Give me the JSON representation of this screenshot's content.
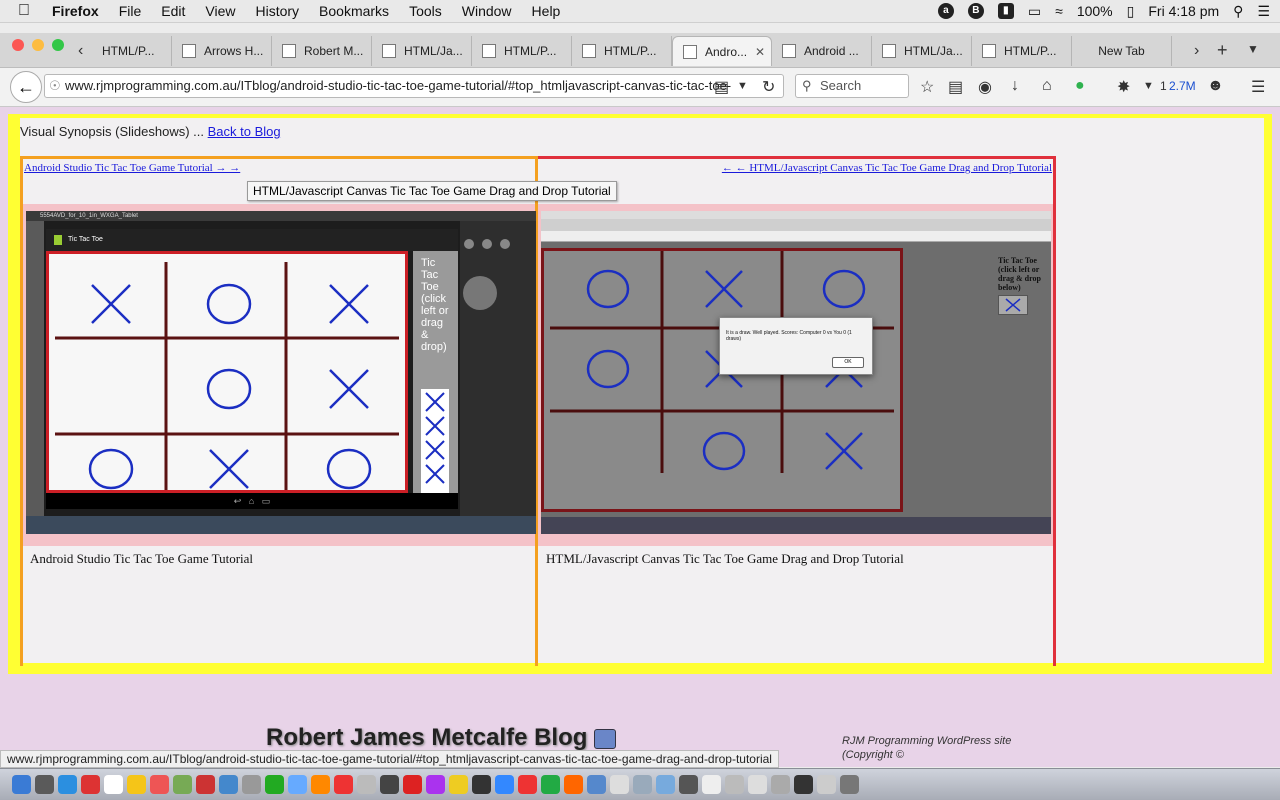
{
  "menubar": {
    "app": "Firefox",
    "items": [
      "File",
      "Edit",
      "View",
      "History",
      "Bookmarks",
      "Tools",
      "Window",
      "Help"
    ],
    "battery": "100%",
    "clock": "Fri 4:18 pm"
  },
  "tabs": [
    {
      "label": "HTML/P..."
    },
    {
      "label": "Arrows H..."
    },
    {
      "label": "Robert M..."
    },
    {
      "label": "HTML/Ja..."
    },
    {
      "label": "HTML/P..."
    },
    {
      "label": "HTML/P..."
    },
    {
      "label": "Andro...",
      "active": true
    },
    {
      "label": "Android ..."
    },
    {
      "label": "HTML/Ja..."
    },
    {
      "label": "HTML/P..."
    },
    {
      "label": "New Tab"
    }
  ],
  "navbar": {
    "url": "www.rjmprogramming.com.au/ITblog/android-studio-tic-tac-toe-game-tutorial/#top_htmljavascript-canvas-tic-tac-toe-",
    "search_placeholder": "Search",
    "download_count": "1",
    "size_label": "2.7M"
  },
  "page": {
    "synopsis_text": "Visual Synopsis (Slideshows) ...",
    "back_link": "Back to Blog",
    "panel1": {
      "link": "Android Studio Tic Tac Toe Game Tutorial → →",
      "caption": "Android Studio Tic Tac Toe Game Tutorial",
      "shot": {
        "window_title": "5554AVD_for_10_1in_WXGA_Tablet",
        "app_title": "Tic Tac Toe",
        "side_text": "Tic Tac Toe (click left or drag & drop)",
        "board": [
          "X",
          "O",
          "X",
          "",
          "O",
          "X",
          "O",
          "X",
          "O"
        ]
      }
    },
    "panel2": {
      "link": "← ← HTML/Javascript Canvas Tic Tac Toe Game Drag and Drop Tutorial",
      "caption": "HTML/Javascript Canvas Tic Tac Toe Game Drag and Drop Tutorial",
      "shot": {
        "side_text": "Tic Tac Toe (click left or drag & drop below)",
        "dialog_text": "It is a draw. Well played. Scores: Computer 0 vs You 0 (1 draws)",
        "dialog_ok": "OK",
        "board": [
          "O",
          "X",
          "O",
          "O",
          "X",
          "X",
          "",
          "O",
          "X"
        ]
      }
    },
    "tooltip": "HTML/Javascript Canvas Tic Tac Toe Game Drag and Drop Tutorial",
    "blog_title": "Robert James Metcalfe Blog",
    "rjm_note_line1": "RJM Programming WordPress site",
    "rjm_note_line2": "(Copyright ©"
  },
  "statusbar": "www.rjmprogramming.com.au/ITblog/android-studio-tic-tac-toe-game-tutorial/#top_htmljavascript-canvas-tic-tac-toe-game-drag-and-drop-tutorial",
  "colors": {
    "frame_yellow": "#ffff33",
    "panel1_border": "#f4a020",
    "panel2_border": "#e0303c",
    "link_blue": "#1a1adb",
    "mark_blue": "#1b2ec2"
  }
}
